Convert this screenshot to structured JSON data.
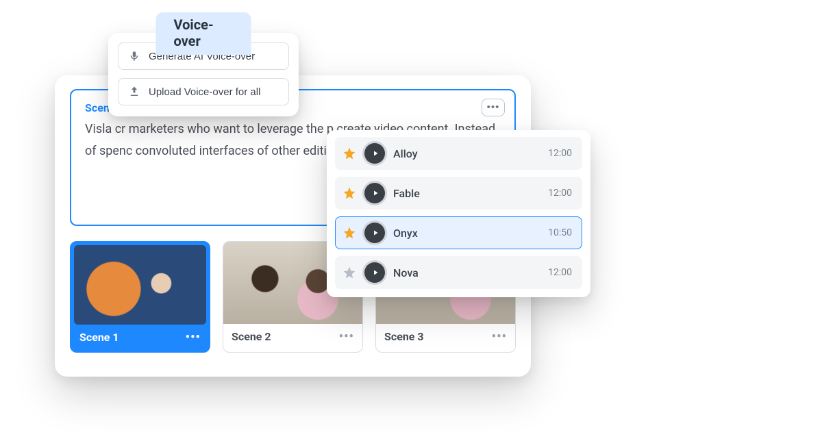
{
  "voiceover_popover": {
    "tab_label": "Voice-over",
    "generate_label": "Generate AI Voice-over",
    "upload_label": "Upload Voice-over for all"
  },
  "script": {
    "scene_label_partial": "Scen",
    "body_text": "Visla                                                       cr                  marketers who want to leverage the p                     create video content. Instead of spenc                    convoluted interfaces of other editing"
  },
  "scenes": [
    {
      "label": "Scene 1",
      "selected": true
    },
    {
      "label": "Scene 2",
      "selected": false
    },
    {
      "label": "Scene 3",
      "selected": false
    }
  ],
  "voices": [
    {
      "name": "Alloy",
      "duration": "12:00",
      "starred": true,
      "selected": false
    },
    {
      "name": "Fable",
      "duration": "12:00",
      "starred": true,
      "selected": false
    },
    {
      "name": "Onyx",
      "duration": "10:50",
      "starred": true,
      "selected": true
    },
    {
      "name": "Nova",
      "duration": "12:00",
      "starred": false,
      "selected": false
    }
  ]
}
